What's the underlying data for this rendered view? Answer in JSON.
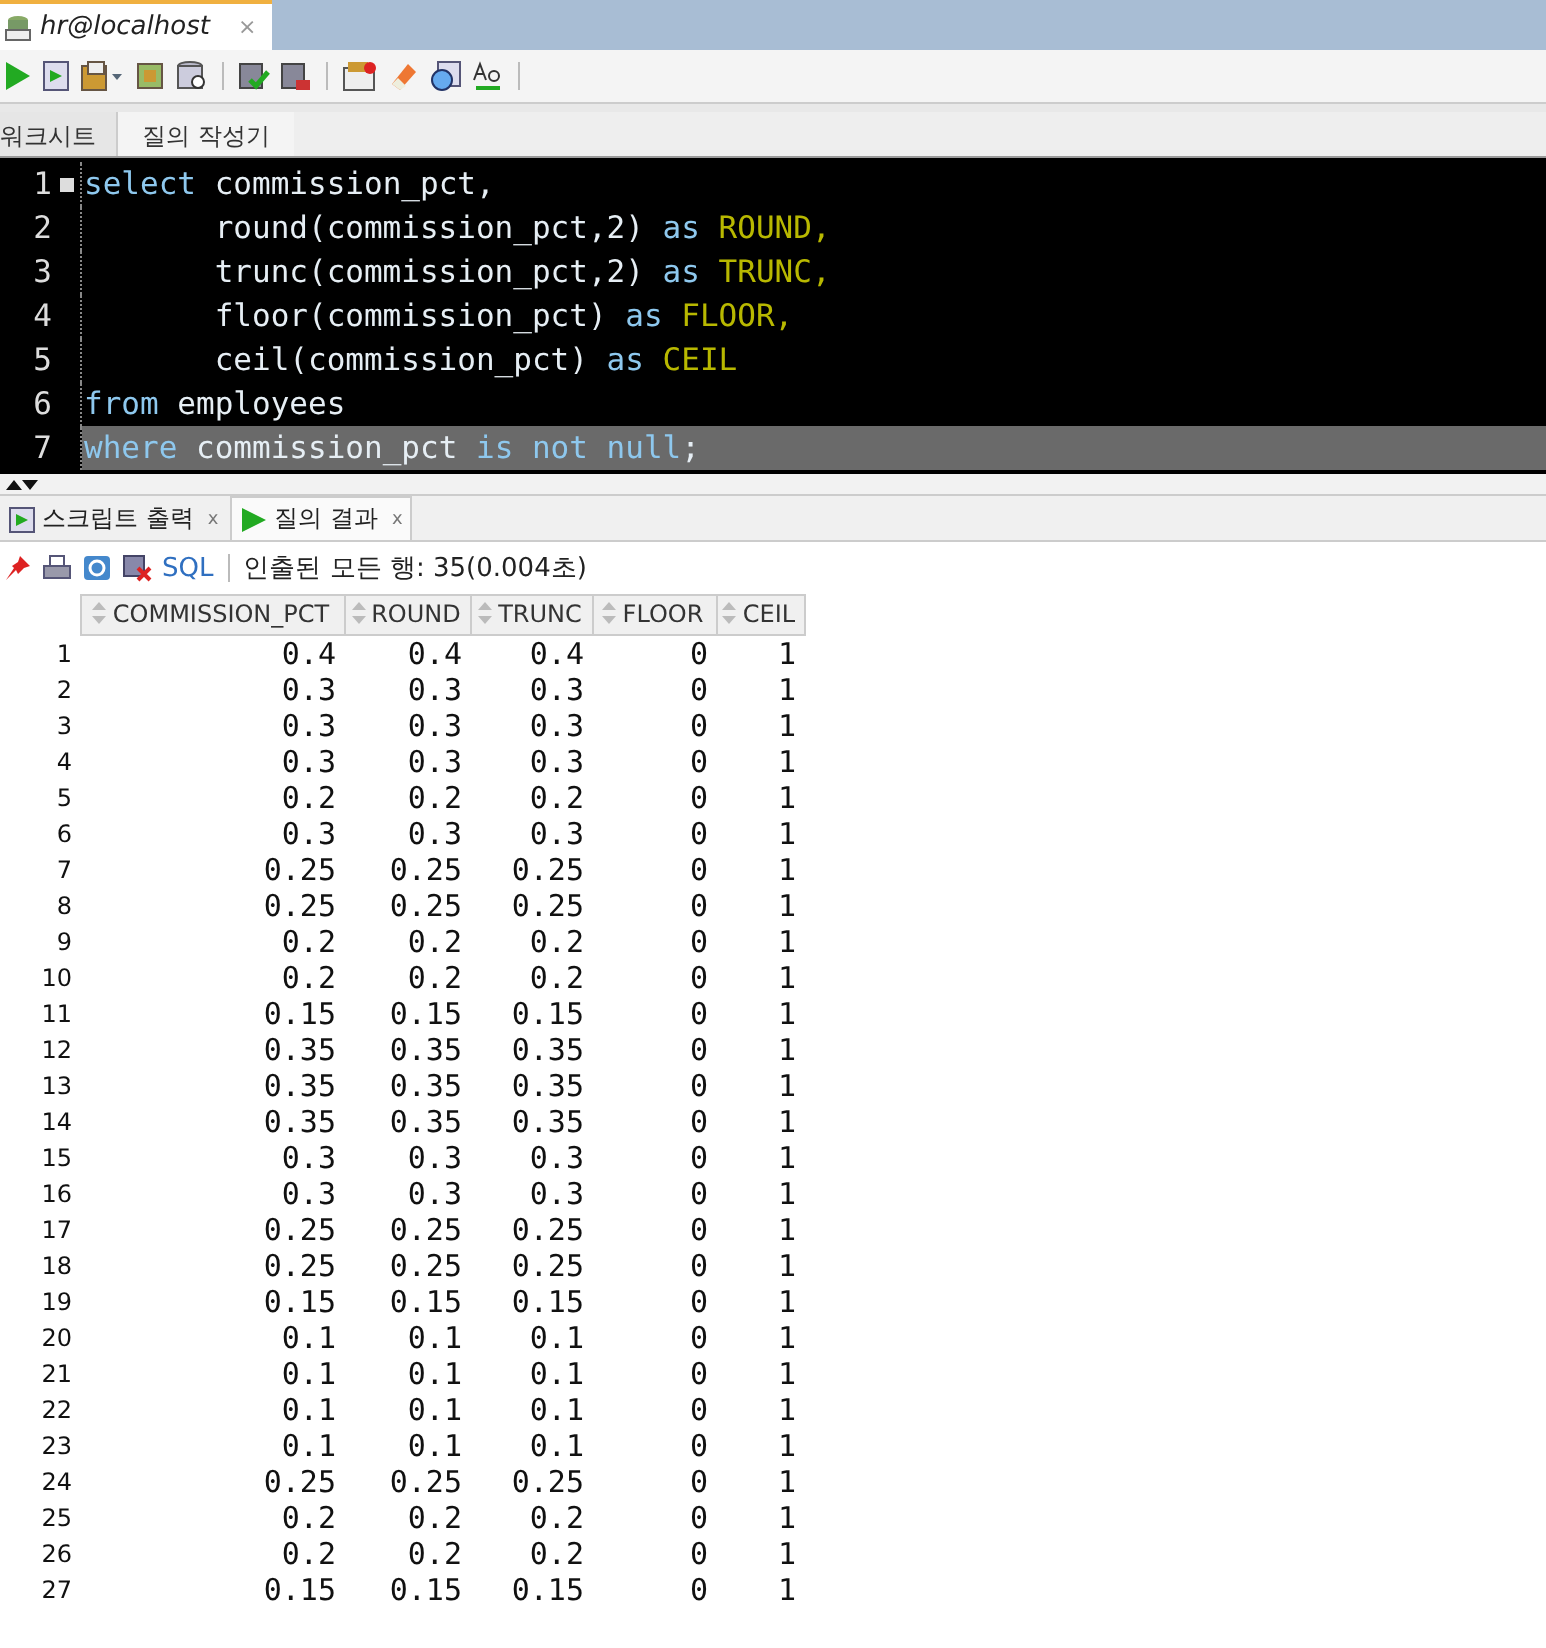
{
  "document_tab": {
    "title": "hr@localhost",
    "close": "×"
  },
  "editor_tabs": [
    {
      "label": "워크시트",
      "selected": true
    },
    {
      "label": "질의 작성기",
      "selected": false
    }
  ],
  "code_lines": [
    {
      "number": "1",
      "folded": true,
      "highlighted": false,
      "segments": [
        {
          "kind": "keyword",
          "text": "select"
        },
        {
          "kind": "plain",
          "text": " commission_pct,"
        }
      ]
    },
    {
      "number": "2",
      "folded": false,
      "highlighted": false,
      "segments": [
        {
          "kind": "plain",
          "text": "       round(commission_pct,2) "
        },
        {
          "kind": "keyword",
          "text": "as"
        },
        {
          "kind": "alias",
          "text": " ROUND,"
        }
      ]
    },
    {
      "number": "3",
      "folded": false,
      "highlighted": false,
      "segments": [
        {
          "kind": "plain",
          "text": "       trunc(commission_pct,2) "
        },
        {
          "kind": "keyword",
          "text": "as"
        },
        {
          "kind": "alias",
          "text": " TRUNC,"
        }
      ]
    },
    {
      "number": "4",
      "folded": false,
      "highlighted": false,
      "segments": [
        {
          "kind": "plain",
          "text": "       floor(commission_pct) "
        },
        {
          "kind": "keyword",
          "text": "as"
        },
        {
          "kind": "alias",
          "text": " FLOOR,"
        }
      ]
    },
    {
      "number": "5",
      "folded": false,
      "highlighted": false,
      "segments": [
        {
          "kind": "plain",
          "text": "       ceil(commission_pct) "
        },
        {
          "kind": "keyword",
          "text": "as"
        },
        {
          "kind": "alias",
          "text": " CEIL"
        }
      ]
    },
    {
      "number": "6",
      "folded": false,
      "highlighted": false,
      "segments": [
        {
          "kind": "keyword",
          "text": "from"
        },
        {
          "kind": "plain",
          "text": " employees"
        }
      ]
    },
    {
      "number": "7",
      "folded": false,
      "highlighted": true,
      "segments": [
        {
          "kind": "keyword",
          "text": "where"
        },
        {
          "kind": "plain",
          "text": " commission_pct "
        },
        {
          "kind": "keyword",
          "text": "is not null"
        },
        {
          "kind": "plain",
          "text": ";"
        }
      ]
    }
  ],
  "result_tabs": [
    {
      "label": "스크립트 출력",
      "close": "x",
      "selected": false,
      "kind": "script"
    },
    {
      "label": "질의 결과",
      "close": "x",
      "selected": true,
      "kind": "query"
    }
  ],
  "result_toolbar": {
    "sql_link": "SQL",
    "status": "인출된 모든 행: 35(0.004초)"
  },
  "table": {
    "columns": [
      "",
      "COMMISSION_PCT",
      "ROUND",
      "TRUNC",
      "FLOOR",
      "CEIL"
    ],
    "rows": [
      [
        "1",
        "0.4",
        "0.4",
        "0.4",
        "0",
        "1"
      ],
      [
        "2",
        "0.3",
        "0.3",
        "0.3",
        "0",
        "1"
      ],
      [
        "3",
        "0.3",
        "0.3",
        "0.3",
        "0",
        "1"
      ],
      [
        "4",
        "0.3",
        "0.3",
        "0.3",
        "0",
        "1"
      ],
      [
        "5",
        "0.2",
        "0.2",
        "0.2",
        "0",
        "1"
      ],
      [
        "6",
        "0.3",
        "0.3",
        "0.3",
        "0",
        "1"
      ],
      [
        "7",
        "0.25",
        "0.25",
        "0.25",
        "0",
        "1"
      ],
      [
        "8",
        "0.25",
        "0.25",
        "0.25",
        "0",
        "1"
      ],
      [
        "9",
        "0.2",
        "0.2",
        "0.2",
        "0",
        "1"
      ],
      [
        "10",
        "0.2",
        "0.2",
        "0.2",
        "0",
        "1"
      ],
      [
        "11",
        "0.15",
        "0.15",
        "0.15",
        "0",
        "1"
      ],
      [
        "12",
        "0.35",
        "0.35",
        "0.35",
        "0",
        "1"
      ],
      [
        "13",
        "0.35",
        "0.35",
        "0.35",
        "0",
        "1"
      ],
      [
        "14",
        "0.35",
        "0.35",
        "0.35",
        "0",
        "1"
      ],
      [
        "15",
        "0.3",
        "0.3",
        "0.3",
        "0",
        "1"
      ],
      [
        "16",
        "0.3",
        "0.3",
        "0.3",
        "0",
        "1"
      ],
      [
        "17",
        "0.25",
        "0.25",
        "0.25",
        "0",
        "1"
      ],
      [
        "18",
        "0.25",
        "0.25",
        "0.25",
        "0",
        "1"
      ],
      [
        "19",
        "0.15",
        "0.15",
        "0.15",
        "0",
        "1"
      ],
      [
        "20",
        "0.1",
        "0.1",
        "0.1",
        "0",
        "1"
      ],
      [
        "21",
        "0.1",
        "0.1",
        "0.1",
        "0",
        "1"
      ],
      [
        "22",
        "0.1",
        "0.1",
        "0.1",
        "0",
        "1"
      ],
      [
        "23",
        "0.1",
        "0.1",
        "0.1",
        "0",
        "1"
      ],
      [
        "24",
        "0.25",
        "0.25",
        "0.25",
        "0",
        "1"
      ],
      [
        "25",
        "0.2",
        "0.2",
        "0.2",
        "0",
        "1"
      ],
      [
        "26",
        "0.2",
        "0.2",
        "0.2",
        "0",
        "1"
      ],
      [
        "27",
        "0.15",
        "0.15",
        "0.15",
        "0",
        "1"
      ]
    ]
  }
}
